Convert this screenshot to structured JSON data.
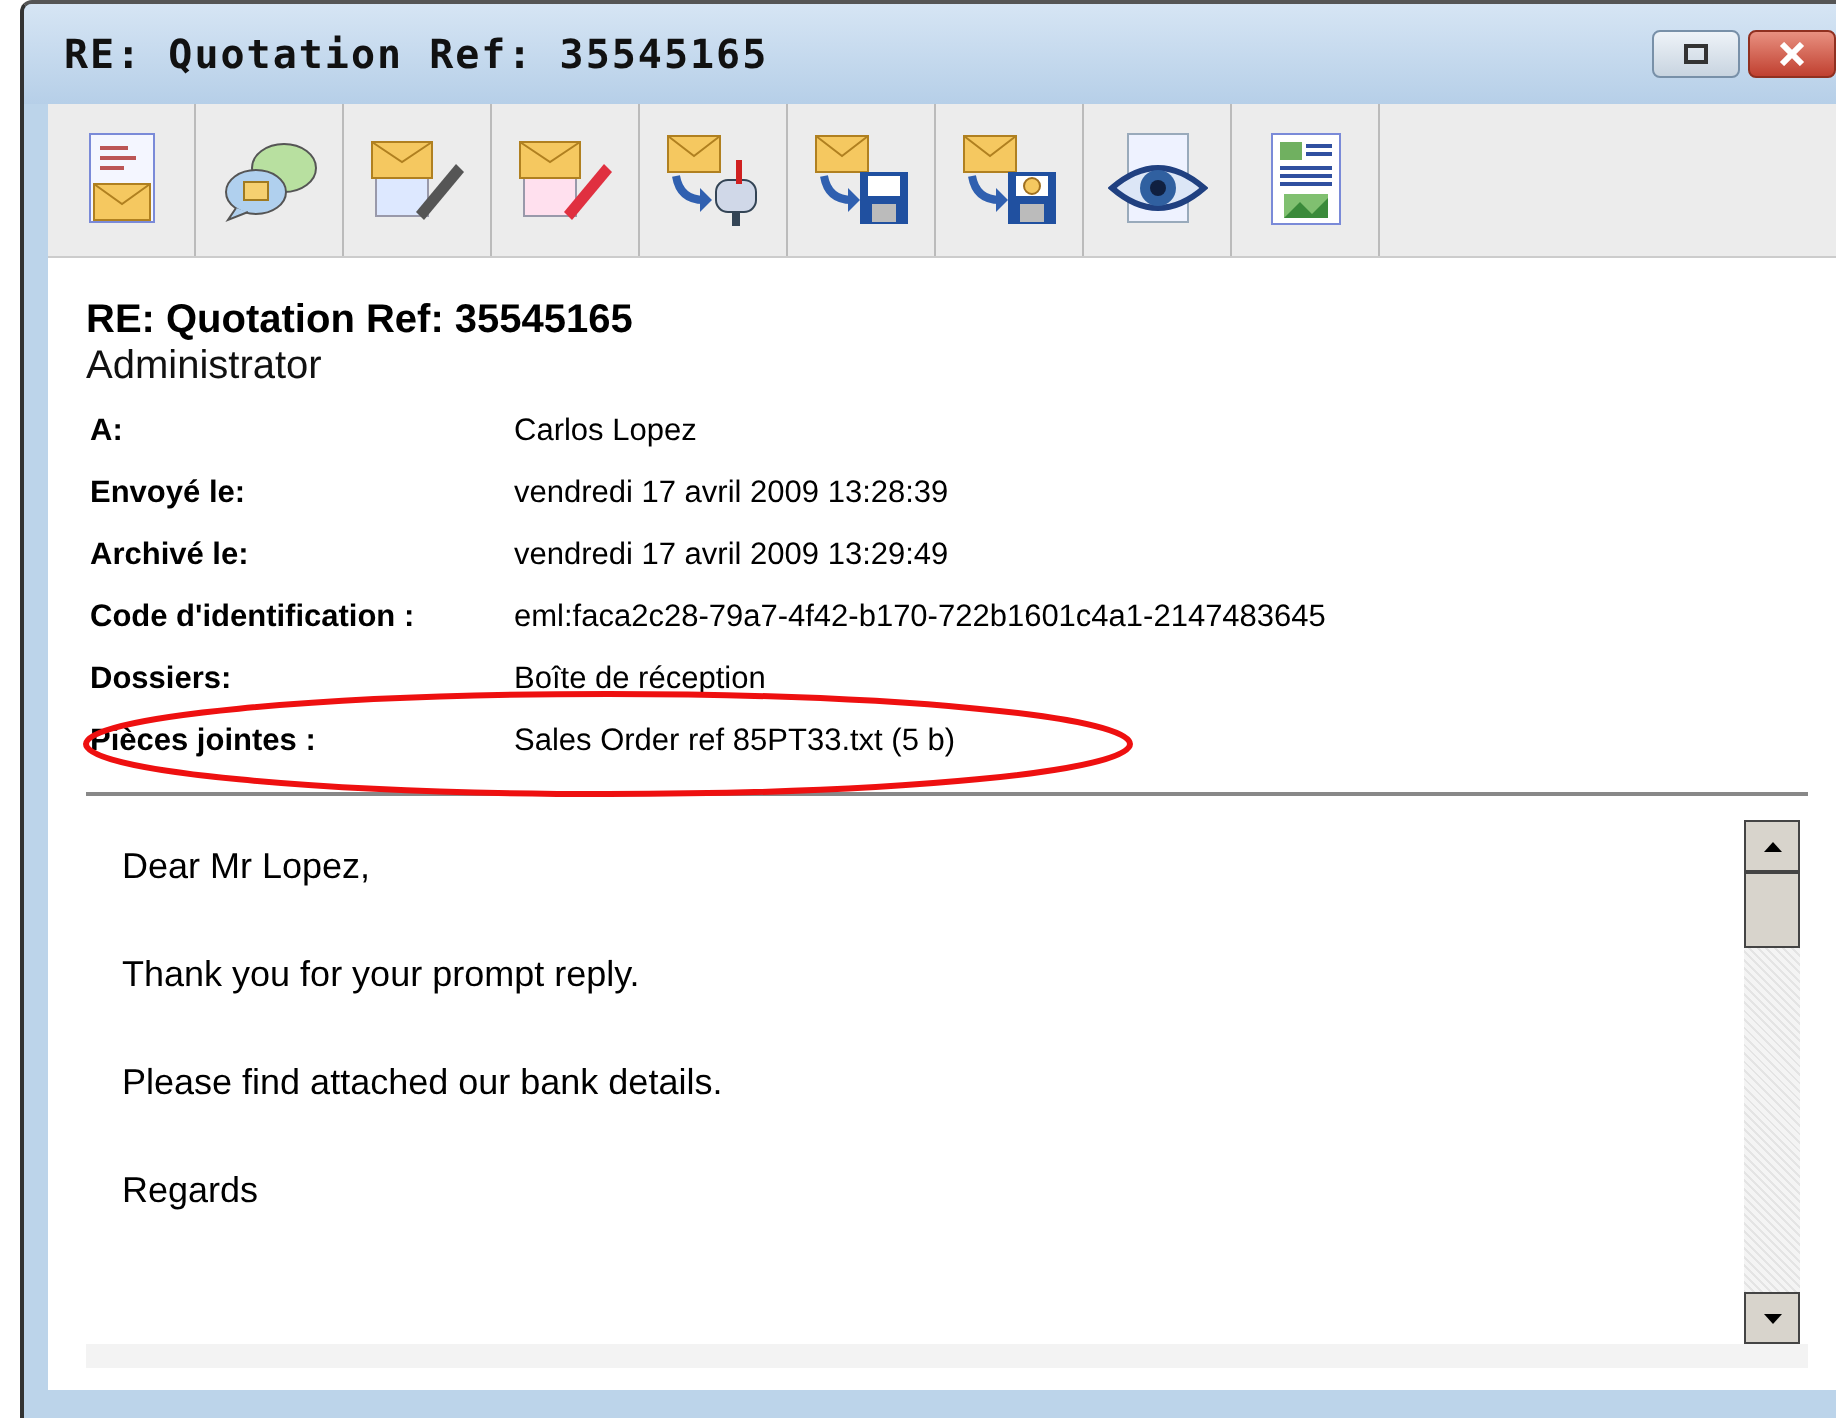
{
  "window": {
    "title": "RE: Quotation Ref: 35545165"
  },
  "toolbar": [
    {
      "kind": "doc-mail"
    },
    {
      "kind": "chat"
    },
    {
      "kind": "edit"
    },
    {
      "kind": "edit-red"
    },
    {
      "kind": "mailbox"
    },
    {
      "kind": "disk"
    },
    {
      "kind": "disk-clock"
    },
    {
      "kind": "eye"
    },
    {
      "kind": "image-doc"
    }
  ],
  "message": {
    "subject": "RE: Quotation Ref: 35545165",
    "sender": "Administrator",
    "fields": [
      {
        "label": "A:",
        "value": "Carlos Lopez"
      },
      {
        "label": "Envoyé le:",
        "value": "vendredi 17 avril 2009 13:28:39"
      },
      {
        "label": "Archivé le:",
        "value": "vendredi 17 avril 2009 13:29:49"
      },
      {
        "label": "Code d'identification :",
        "value": "eml:faca2c28-79a7-4f42-b170-722b1601c4a1-2147483645"
      },
      {
        "label": "Dossiers:",
        "value": "Boîte de réception"
      },
      {
        "label": "Pièces jointes :",
        "value": "Sales Order ref 85PT33.txt (5 b)",
        "highlighted": true
      }
    ],
    "body": [
      "Dear Mr Lopez,",
      "Thank you for your prompt reply.",
      "Please find attached our bank details.",
      "Regards"
    ]
  }
}
